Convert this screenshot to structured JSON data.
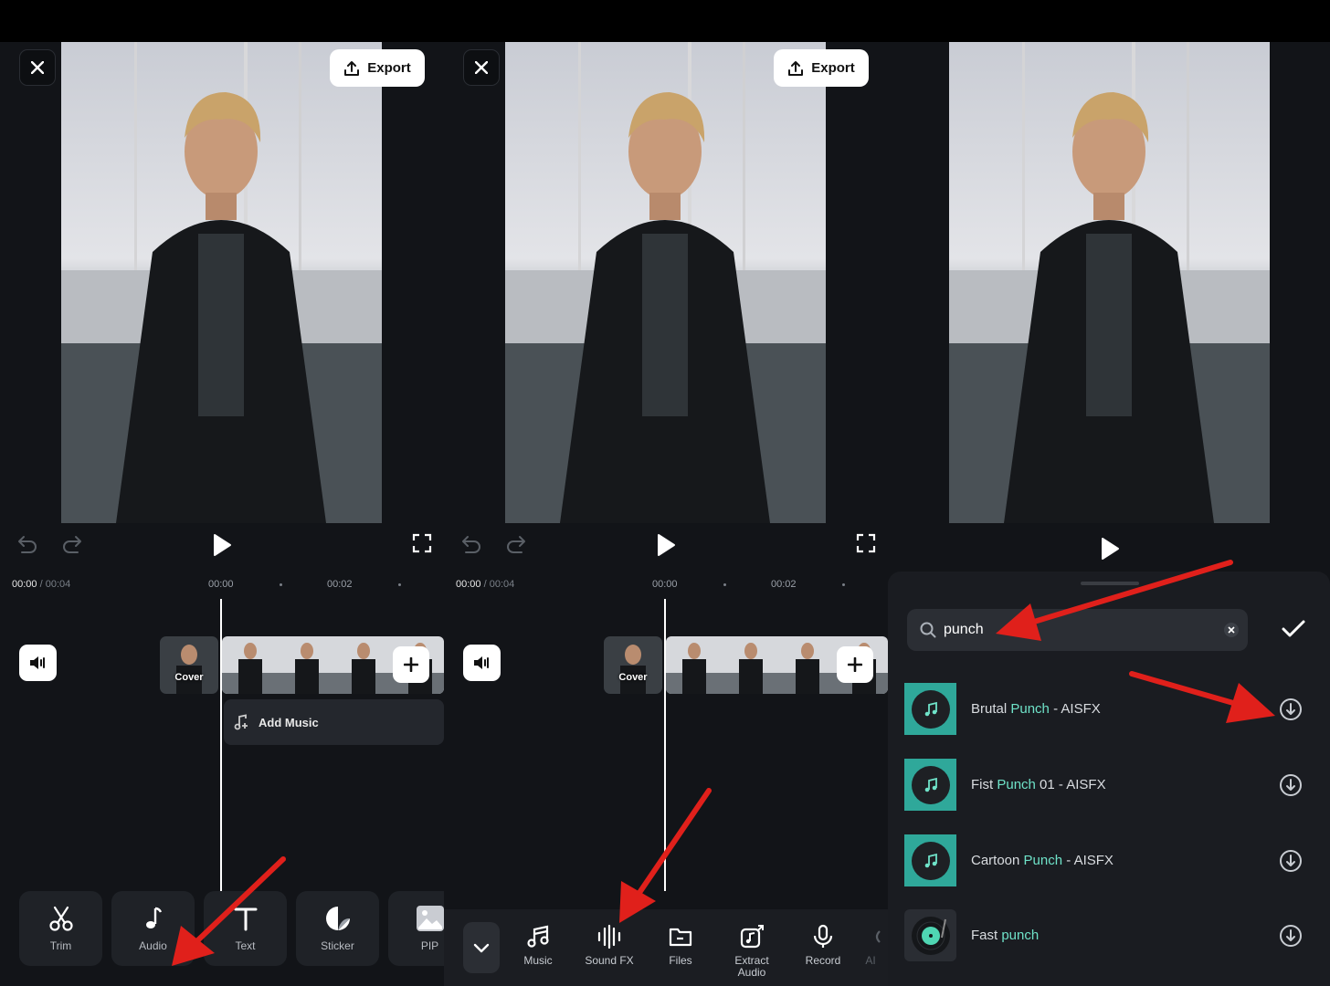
{
  "panel1": {
    "export_label": "Export",
    "time_current": "00:00",
    "time_total": "/ 00:04",
    "tick_0": "00:00",
    "tick_2": "00:02",
    "cover_label": "Cover",
    "add_music_label": "Add Music",
    "tools": [
      {
        "label": "Trim",
        "icon": "scissors-icon"
      },
      {
        "label": "Audio",
        "icon": "music-note-icon"
      },
      {
        "label": "Text",
        "icon": "text-icon"
      },
      {
        "label": "Sticker",
        "icon": "sticker-icon"
      },
      {
        "label": "PIP",
        "icon": "image-icon"
      }
    ]
  },
  "panel2": {
    "export_label": "Export",
    "time_current": "00:00",
    "time_total": "/ 00:04",
    "tick_0": "00:00",
    "tick_2": "00:02",
    "cover_label": "Cover",
    "tools": [
      {
        "label": "Music",
        "icon": "music-icon"
      },
      {
        "label": "Sound FX",
        "icon": "sound-wave-icon"
      },
      {
        "label": "Files",
        "icon": "folder-icon"
      },
      {
        "label": "Extract Audio",
        "icon": "extract-audio-icon"
      },
      {
        "label": "Record",
        "icon": "microphone-icon"
      },
      {
        "label": "AI",
        "icon": "ai-icon"
      }
    ]
  },
  "panel3": {
    "search_value": "punch",
    "results": [
      {
        "pre": "Brutal ",
        "hl": "Punch",
        "post": " - AISFX"
      },
      {
        "pre": "Fist ",
        "hl": "Punch",
        "post": " 01 - AISFX"
      },
      {
        "pre": "Cartoon ",
        "hl": "Punch",
        "post": " - AISFX"
      },
      {
        "pre": "Fast ",
        "hl": "punch",
        "post": ""
      }
    ]
  },
  "colors": {
    "accent": "#6fe3c9",
    "annotation_arrow": "#e0201b",
    "thumb": "#2fa89a"
  }
}
